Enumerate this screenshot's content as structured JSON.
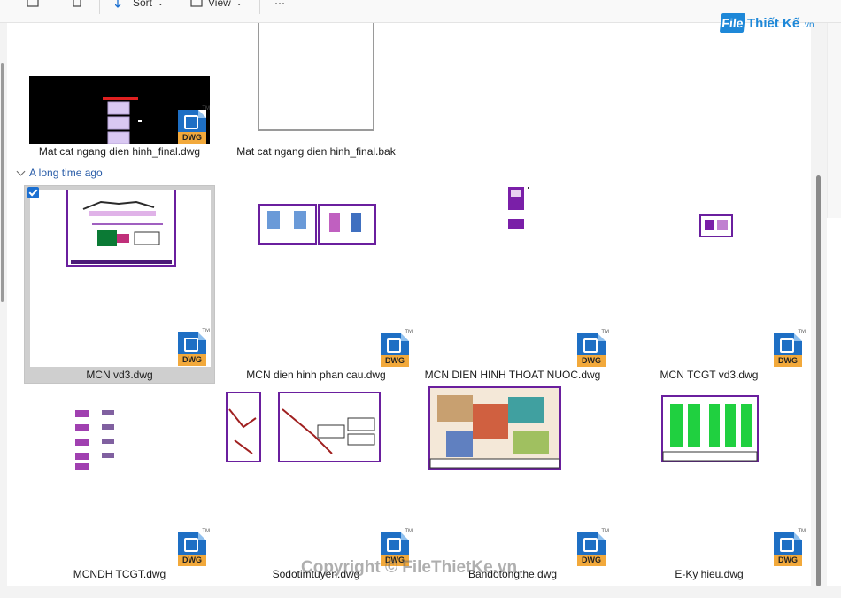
{
  "toolbar": {
    "sort_label": "Sort",
    "view_label": "View",
    "more_label": "···"
  },
  "group": {
    "header": "A long time ago"
  },
  "files": [
    {
      "name": "Mat cat ngang dien hinh_final.dwg",
      "badge": "DWG"
    },
    {
      "name": "Mat cat ngang dien hinh_final.bak"
    },
    {
      "name": "MCN vd3.dwg",
      "badge": "DWG",
      "selected": true
    },
    {
      "name": "MCN dien hinh phan cau.dwg",
      "badge": "DWG"
    },
    {
      "name": "MCN DIEN HINH THOAT NUOC.dwg",
      "badge": "DWG"
    },
    {
      "name": "MCN TCGT vd3.dwg",
      "badge": "DWG"
    },
    {
      "name": "MCNDH TCGT.dwg",
      "badge": "DWG"
    },
    {
      "name": "Sodotimtuyen.dwg",
      "badge": "DWG"
    },
    {
      "name": "Bandotongthe.dwg",
      "badge": "DWG"
    },
    {
      "name": "E-Ky hieu.dwg",
      "badge": "DWG"
    }
  ],
  "watermark": {
    "logo_file": "File",
    "logo_brand": "Thiết Kế",
    "logo_tld": ".vn",
    "copyright": "Copyright © FileThietKe.vn"
  },
  "icons": {
    "badge_mark": "TM"
  },
  "colors": {
    "accent": "#1b6fd1",
    "dwg_blue": "#1e6fc4",
    "dwg_orange": "#f2a93b",
    "cad_magenta": "#7a1fa8"
  }
}
